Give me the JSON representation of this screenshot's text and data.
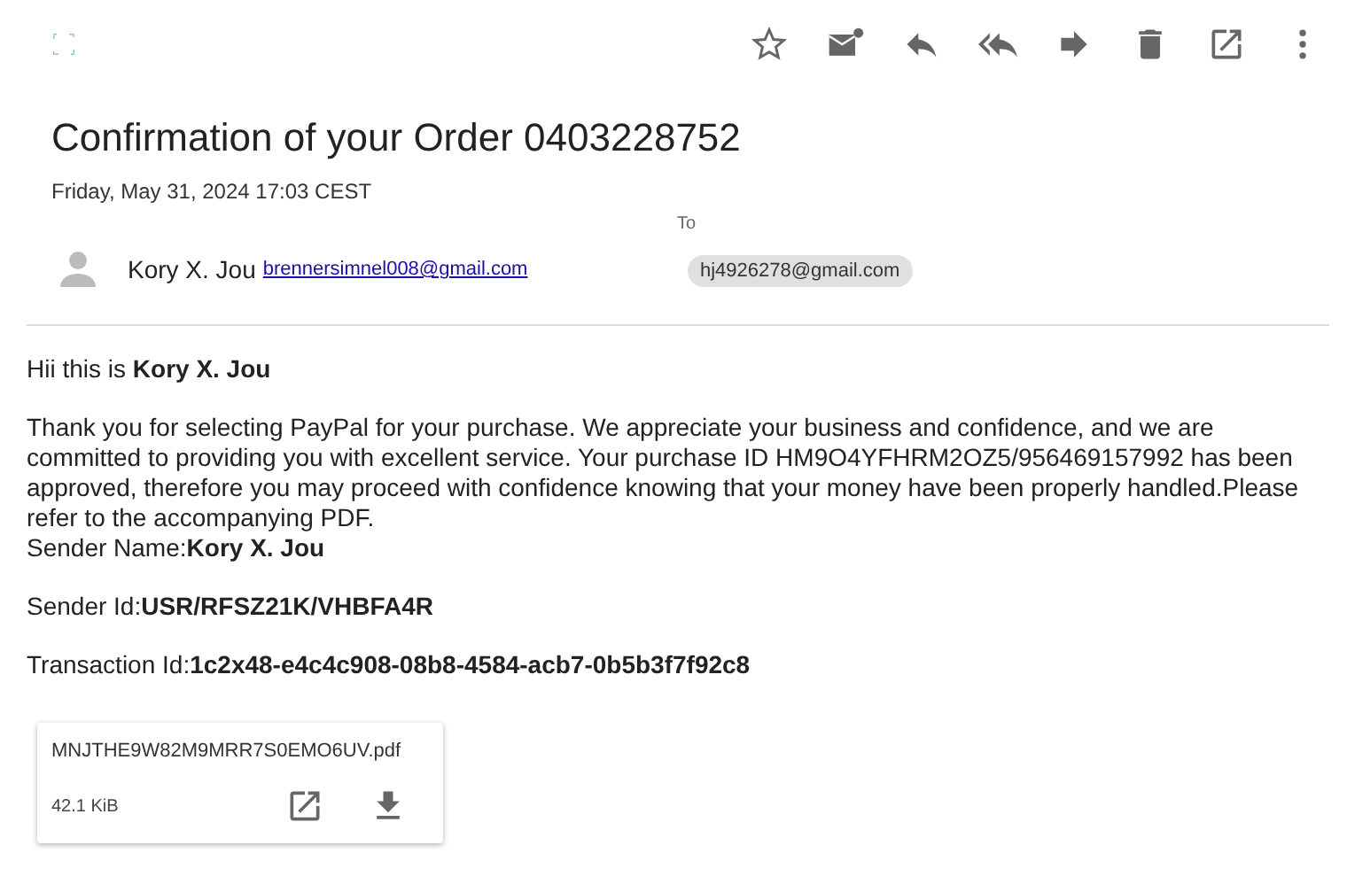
{
  "message": {
    "subject": "Confirmation of your Order 0403228752",
    "date": "Friday, May 31, 2024 17:03 CEST",
    "sender_name": "Kory X. Jou",
    "sender_email": "brennersimnel008@gmail.com",
    "to_label": "To",
    "recipients": [
      "hj4926278@gmail.com"
    ]
  },
  "body": [
    [
      "Hii this is **Kory X. Jou**"
    ],
    [
      "Thank you for selecting PayPal for your purchase. We appreciate your business and confidence, and we are committed to providing you with excellent service. Your purchase ID HM9O4YFHRM2OZ5/956469157992 has been approved, therefore you may proceed with confidence knowing that your money have been properly handled.Please refer to the accompanying PDF.",
      "Sender Name:**Kory X. Jou**"
    ],
    [
      "Sender Id:**USR/RFSZ21K/VHBFA4R**"
    ],
    [
      "Transaction Id:**1c2x48-e4c4c908-08b8-4584-acb7-0b5b3f7f92c8**"
    ]
  ],
  "attachments": [
    {
      "filename": "MNJTHE9W82M9MRR7S0EMO6UV.pdf",
      "size": "42.1 KiB"
    }
  ]
}
